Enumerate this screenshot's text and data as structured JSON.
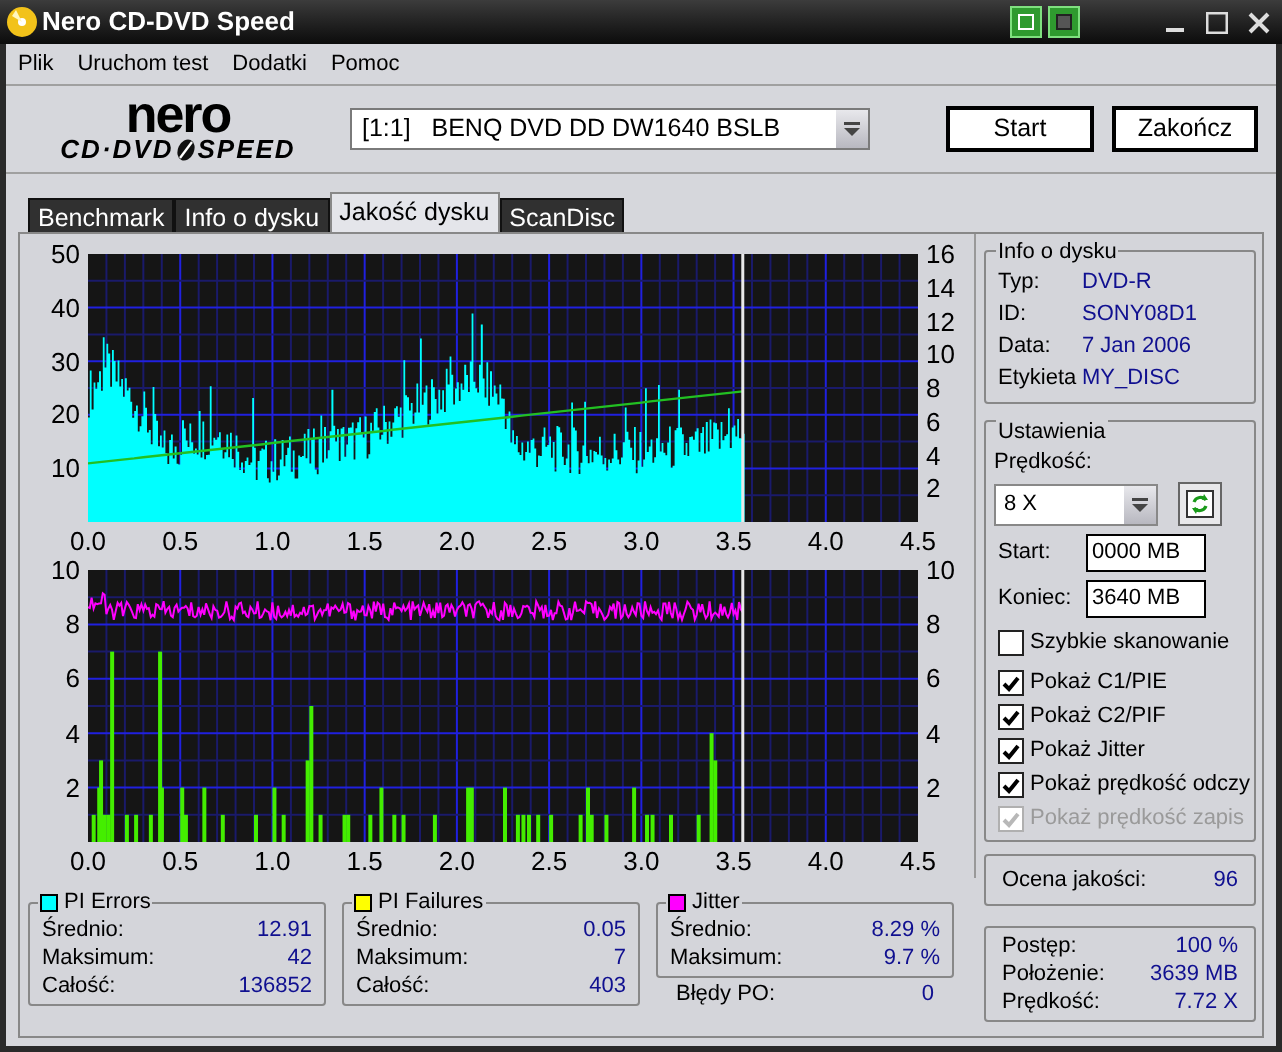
{
  "window": {
    "title": "Nero CD-DVD Speed"
  },
  "menu": [
    "Plik",
    "Uruchom test",
    "Dodatki",
    "Pomoc"
  ],
  "logo": {
    "brand": "nero",
    "product_left": "CD·DVD",
    "product_right": "SPEED"
  },
  "drive": {
    "value": "[1:1]   BENQ DVD DD DW1640 BSLB"
  },
  "buttons": [
    "Start",
    "Zakończ"
  ],
  "tabs": [
    {
      "label": "Benchmark",
      "selected": false
    },
    {
      "label": "Info o dysku",
      "selected": false
    },
    {
      "label": "Jakość dysku",
      "selected": true
    },
    {
      "label": "ScanDisc",
      "selected": false
    }
  ],
  "charts": [
    {
      "left_ticks": [
        "50",
        "40",
        "30",
        "20",
        "10"
      ],
      "right_ticks": [
        "16",
        "14",
        "12",
        "10",
        "8",
        "6",
        "4",
        "2"
      ],
      "x_ticks": [
        "0.0",
        "0.5",
        "1.0",
        "1.5",
        "2.0",
        "2.5",
        "3.0",
        "3.5",
        "4.0",
        "4.5"
      ]
    },
    {
      "left_ticks": [
        "10",
        "8",
        "6",
        "4",
        "2"
      ],
      "right_ticks": [
        "10",
        "8",
        "6",
        "4",
        "2"
      ],
      "x_ticks": [
        "0.0",
        "0.5",
        "1.0",
        "1.5",
        "2.0",
        "2.5",
        "3.0",
        "3.5",
        "4.0",
        "4.5"
      ]
    }
  ],
  "disc_info": {
    "title": "Info o dysku",
    "rows": [
      {
        "label": "Typ:",
        "value": "DVD-R"
      },
      {
        "label": "ID:",
        "value": "SONY08D1"
      },
      {
        "label": "Data:",
        "value": "7 Jan 2006"
      },
      {
        "label": "Etykieta",
        "value": "MY_DISC"
      }
    ]
  },
  "settings": {
    "title": "Ustawienia",
    "speed_label": "Prędkość:",
    "speed": "8 X",
    "start_label": "Start:",
    "start": "0000 MB",
    "end_label": "Koniec:",
    "end": "3640 MB",
    "options": [
      {
        "label": "Szybkie skanowanie",
        "checked": false,
        "disabled": false
      },
      {
        "label": "Pokaż C1/PIE",
        "checked": true,
        "disabled": false
      },
      {
        "label": "Pokaż C2/PIF",
        "checked": true,
        "disabled": false
      },
      {
        "label": "Pokaż Jitter",
        "checked": true,
        "disabled": false
      },
      {
        "label": "Pokaż prędkość odczy",
        "checked": true,
        "disabled": false
      },
      {
        "label": "Pokaż prędkość zapis",
        "checked": true,
        "disabled": true
      }
    ]
  },
  "quality": {
    "label": "Ocena jakości:",
    "value": "96"
  },
  "stats": [
    {
      "title": "PI Errors",
      "color": "#00ffff",
      "rows": [
        {
          "label": "Średnio:",
          "value": "12.91"
        },
        {
          "label": "Maksimum:",
          "value": "42"
        },
        {
          "label": "Całość:",
          "value": "136852"
        }
      ]
    },
    {
      "title": "PI Failures",
      "color": "#ffff00",
      "rows": [
        {
          "label": "Średnio:",
          "value": "0.05"
        },
        {
          "label": "Maksimum:",
          "value": "7"
        },
        {
          "label": "Całość:",
          "value": "403"
        }
      ]
    },
    {
      "title": "Jitter",
      "color": "#ff00ff",
      "rows": [
        {
          "label": "Średnio:",
          "value": "8.29 %"
        },
        {
          "label": "Maksimum:",
          "value": "9.7 %"
        }
      ]
    }
  ],
  "po_errors": {
    "label": "Błędy PO:",
    "value": "0"
  },
  "progress": [
    {
      "label": "Postęp:",
      "value": "100 %"
    },
    {
      "label": "Położenie:",
      "value": "3639 MB"
    },
    {
      "label": "Prędkość:",
      "value": "7.72 X"
    }
  ]
}
